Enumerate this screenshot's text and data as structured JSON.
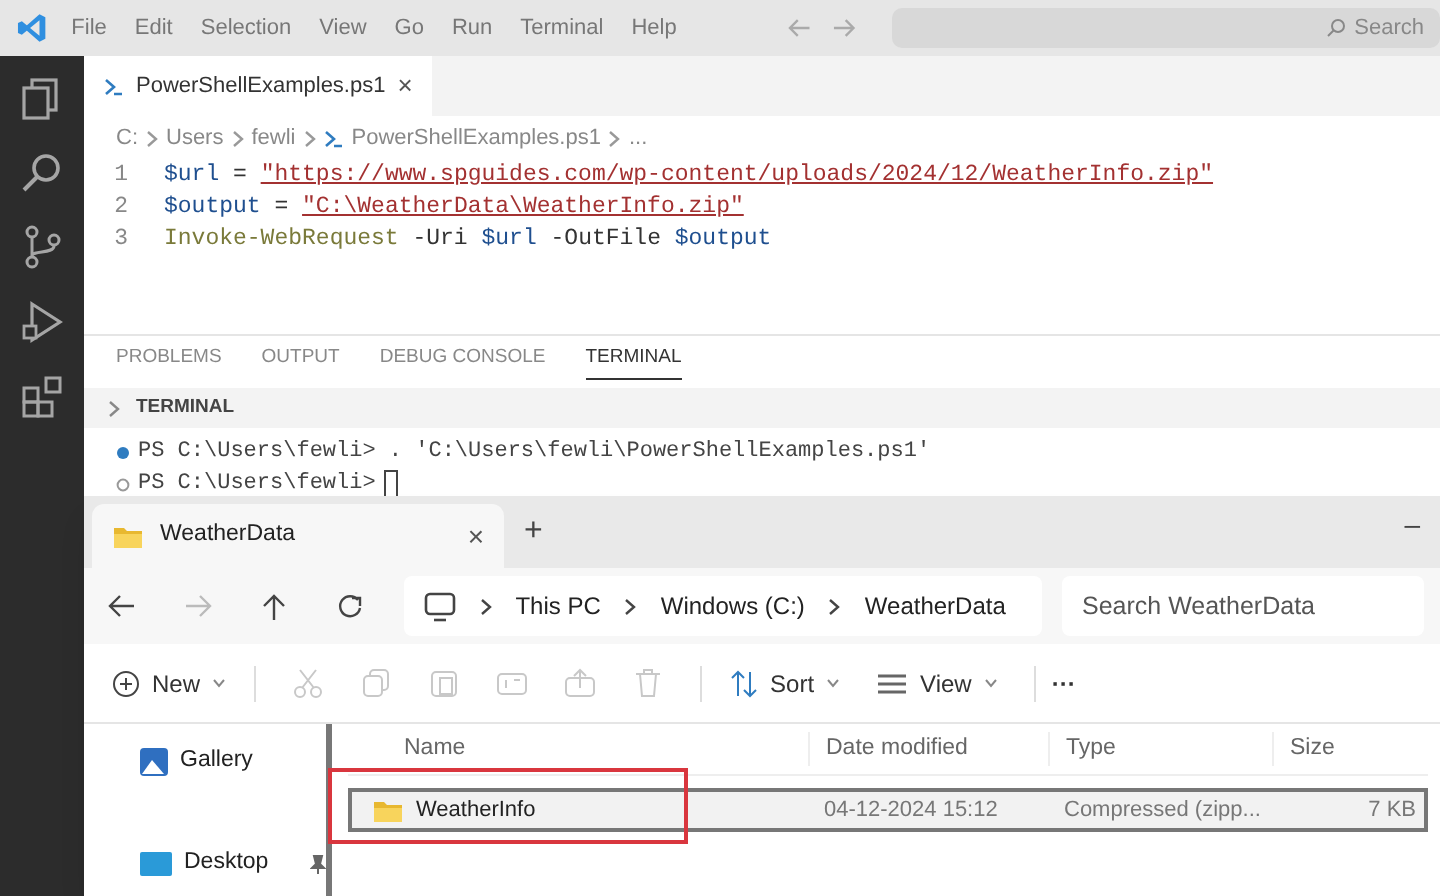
{
  "menu": {
    "items": [
      "File",
      "Edit",
      "Selection",
      "View",
      "Go",
      "Run",
      "Terminal",
      "Help"
    ],
    "search": {
      "placeholder": "Search"
    }
  },
  "activity_bar": [
    {
      "kind": "files",
      "selected": false
    },
    {
      "kind": "search",
      "selected": false
    },
    {
      "kind": "source-control",
      "selected": false
    },
    {
      "kind": "run",
      "selected": false
    },
    {
      "kind": "extensions",
      "selected": false
    }
  ],
  "editor": {
    "tab": {
      "label": "PowerShellExamples.ps1",
      "close": "×"
    },
    "breadcrumb": [
      "C:",
      "Users",
      "fewli",
      "PowerShellExamples.ps1",
      "..."
    ],
    "lines": [
      {
        "number": "1",
        "tokens": [
          {
            "kind": "var",
            "text": "$url"
          },
          {
            "kind": "op",
            "text": " = "
          },
          {
            "kind": "string",
            "text": "\"https://www.spguides.com/wp-content/uploads/2024/12/WeatherInfo.zip\""
          }
        ]
      },
      {
        "number": "2",
        "tokens": [
          {
            "kind": "var",
            "text": "$output"
          },
          {
            "kind": "op",
            "text": " = "
          },
          {
            "kind": "string",
            "text": "\"C:\\WeatherData\\WeatherInfo.zip\""
          }
        ]
      },
      {
        "number": "3",
        "tokens": [
          {
            "kind": "cmd",
            "text": "Invoke-WebRequest"
          },
          {
            "kind": "op",
            "text": " -Uri "
          },
          {
            "kind": "var",
            "text": "$url"
          },
          {
            "kind": "op",
            "text": " -OutFile "
          },
          {
            "kind": "var",
            "text": "$output"
          }
        ]
      }
    ]
  },
  "panel": {
    "tabs": [
      {
        "label": "PROBLEMS",
        "selected": false
      },
      {
        "label": "OUTPUT",
        "selected": false
      },
      {
        "label": "DEBUG CONSOLE",
        "selected": false
      },
      {
        "label": "TERMINAL",
        "selected": true
      }
    ],
    "section": "TERMINAL",
    "terminal": [
      {
        "done": true,
        "prompt": "PS C:\\Users\\fewli>",
        "command": ". 'C:\\Users\\fewli\\PowerShellExamples.ps1'"
      },
      {
        "done": false,
        "prompt": "PS C:\\Users\\fewli>",
        "cursor": true
      }
    ]
  },
  "explorer": {
    "tab": {
      "label": "WeatherData",
      "close": "×",
      "new": "+"
    },
    "minimize": "–",
    "address": [
      "This PC",
      "Windows (C:)",
      "WeatherData"
    ],
    "search": {
      "placeholder": "Search WeatherData"
    },
    "toolbar": [
      {
        "kind": "new",
        "label": "New"
      },
      {
        "kind": "cut",
        "disabled": true
      },
      {
        "kind": "copy",
        "disabled": true
      },
      {
        "kind": "paste",
        "disabled": true
      },
      {
        "kind": "rename",
        "disabled": true
      },
      {
        "kind": "share",
        "disabled": true
      },
      {
        "kind": "delete",
        "disabled": true
      },
      {
        "kind": "sort",
        "label": "Sort"
      },
      {
        "kind": "view",
        "label": "View"
      },
      {
        "kind": "more",
        "label": "···"
      }
    ],
    "sidebar": [
      {
        "label": "Gallery",
        "kind": "gallery",
        "pinned": false
      },
      {
        "label": "Desktop",
        "kind": "desktop",
        "pinned": true
      }
    ],
    "columns": [
      "Name",
      "Date modified",
      "Type",
      "Size"
    ],
    "rows": [
      {
        "name": "WeatherInfo",
        "date": "04-12-2024 15:12",
        "type": "Compressed (zipp...",
        "size": "7 KB",
        "selected": true,
        "highlighted": true
      }
    ]
  }
}
